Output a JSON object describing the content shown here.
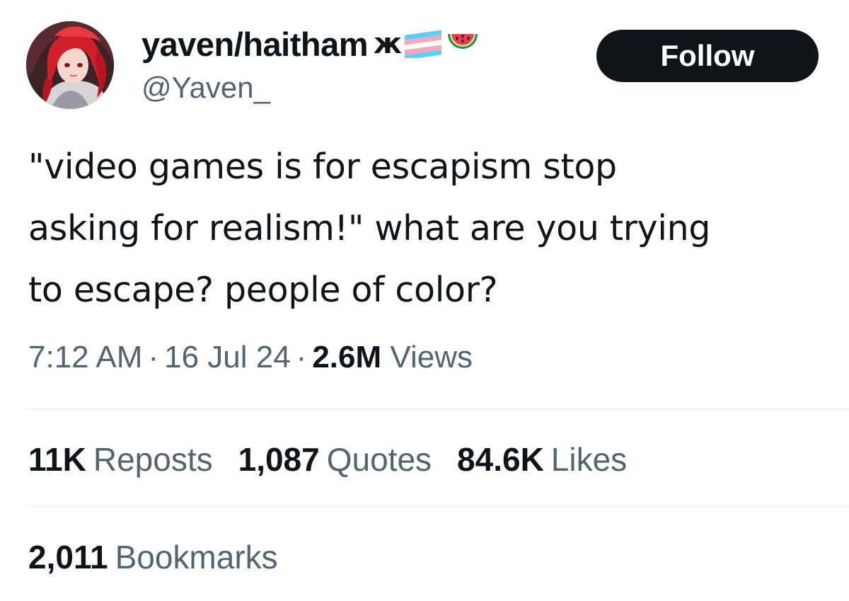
{
  "author": {
    "display_name": "yaven/haitham",
    "name_glyph": "ж",
    "emoji_icons": [
      "transgender-flag-icon",
      "watermelon-icon"
    ],
    "handle": "@Yaven_",
    "avatar_icon": "red-haired-anime-avatar"
  },
  "follow_button": {
    "label": "Follow"
  },
  "tweet": {
    "text": "\"video games is for escapism stop\nasking for realism!\" what are you trying\nto escape? people of color?"
  },
  "meta": {
    "time": "7:12 AM",
    "separator": "·",
    "date": "16 Jul 24",
    "views_count": "2.6M",
    "views_label": "Views"
  },
  "stats": {
    "reposts": {
      "count": "11K",
      "label": "Reposts"
    },
    "quotes": {
      "count": "1,087",
      "label": "Quotes"
    },
    "likes": {
      "count": "84.6K",
      "label": "Likes"
    },
    "bookmarks": {
      "count": "2,011",
      "label": "Bookmarks"
    }
  },
  "colors": {
    "text_primary": "#0f1419",
    "text_secondary": "#536471",
    "button_bg": "#0f1419",
    "divider": "#eff3f4"
  }
}
